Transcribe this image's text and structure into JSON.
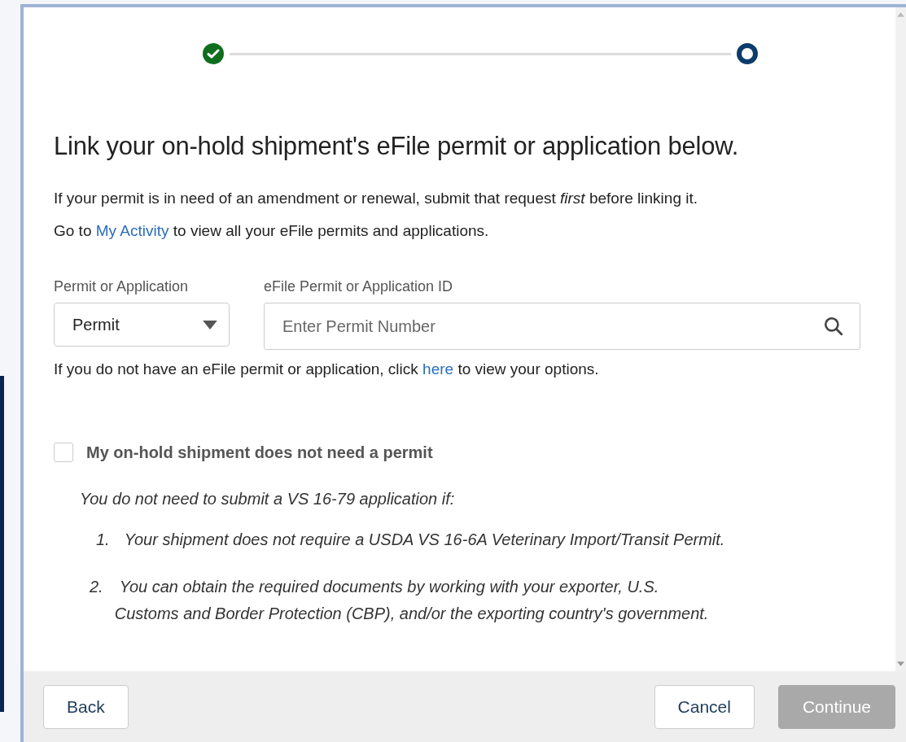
{
  "steps": [
    {
      "completed": true
    },
    {
      "completed": false
    }
  ],
  "heading": "Link your on-hold shipment's eFile permit or application below.",
  "intro": [
    "If your permit is in need of an amendment or renewal, submit that request *first* before linking it."
  ],
  "activity_line": {
    "before": "Go to",
    "link": "My Activity",
    "after": "to view all your eFile permits and applications."
  },
  "type_field": {
    "label": "Permit or Application",
    "value": "Permit"
  },
  "id_field": {
    "label": "eFile Permit or Application ID",
    "placeholder": "Enter Permit Number"
  },
  "options_line": {
    "before": "If you do not have an eFile permit or application, click",
    "link": "here",
    "after": "to view your options."
  },
  "no_permit": {
    "label": "My on-hold shipment does not need a permit",
    "checked": false
  },
  "note": "You do not need to submit a VS 16-79 application if:",
  "conditions": [
    {
      "number": "1.",
      "lines": [
        "Your shipment does not require a USDA VS 16-6A Veterinary Import/Transit Permit."
      ]
    },
    {
      "number": "2.",
      "lines": [
        "You can obtain the required documents by working with your exporter, U.S.",
        "Customs and Border Protection (CBP), and/or the exporting country's government."
      ]
    }
  ],
  "left_buttons": [
    {
      "label": "Back",
      "disabled": false
    }
  ],
  "right_buttons": [
    {
      "label": "Cancel",
      "disabled": false
    },
    {
      "label": "Continue",
      "disabled": true
    }
  ]
}
